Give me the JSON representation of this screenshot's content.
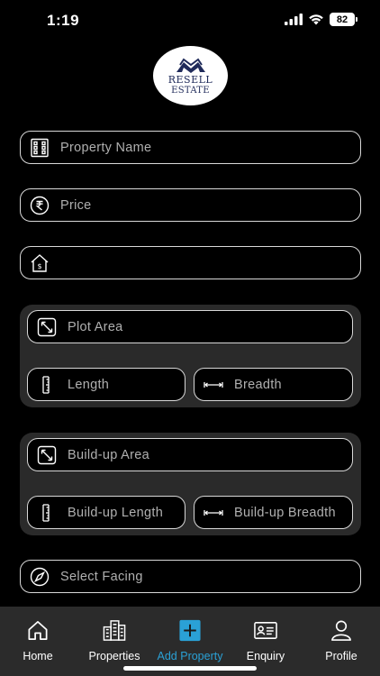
{
  "status_bar": {
    "time": "1:19",
    "battery": "82"
  },
  "logo": {
    "line1": "RESELL",
    "line2": "ESTATE"
  },
  "form": {
    "property_name": {
      "placeholder": "Property Name",
      "icon": "building-icon"
    },
    "price": {
      "placeholder": "Price",
      "icon": "rupee-icon"
    },
    "property_type": {
      "placeholder": "",
      "icon": "house-dollar-icon"
    },
    "plot_area": {
      "placeholder": "Plot Area",
      "icon": "expand-diagonal-icon"
    },
    "length": {
      "placeholder": "Length",
      "icon": "vertical-ruler-icon"
    },
    "breadth": {
      "placeholder": "Breadth",
      "icon": "horizontal-ruler-icon"
    },
    "buildup_area": {
      "placeholder": "Build-up Area",
      "icon": "expand-diagonal-icon"
    },
    "buildup_length": {
      "placeholder": "Build-up Length",
      "icon": "vertical-ruler-icon"
    },
    "buildup_breadth": {
      "placeholder": "Build-up Breadth",
      "icon": "horizontal-ruler-icon"
    },
    "facing": {
      "placeholder": "Select Facing",
      "icon": "compass-icon"
    }
  },
  "bottom_nav": {
    "active_color": "#2aa1d6",
    "items": [
      {
        "label": "Home",
        "icon": "home-icon"
      },
      {
        "label": "Properties",
        "icon": "buildings-icon"
      },
      {
        "label": "Add Property",
        "icon": "plus-square-icon",
        "active": true
      },
      {
        "label": "Enquiry",
        "icon": "id-card-icon"
      },
      {
        "label": "Profile",
        "icon": "user-icon"
      }
    ]
  }
}
